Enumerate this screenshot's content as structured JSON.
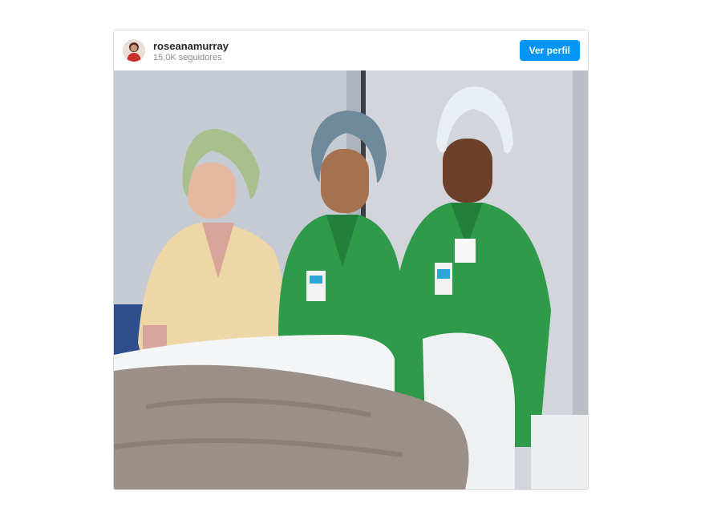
{
  "post": {
    "username": "roseanamurray",
    "followers": "15,0K seguidores",
    "view_profile_label": "Ver perfil",
    "avatar_icon": "user-avatar-icon"
  },
  "photo": {
    "subject": "three nurses in scrubs and caps beside a hospital bed",
    "colors": {
      "wall": "#c9ced6",
      "scrubs_green": "#2e9a4a",
      "scrubs_beige": "#eed7a6",
      "blanket": "#9a9089",
      "bed": "#f4f5f6"
    }
  }
}
